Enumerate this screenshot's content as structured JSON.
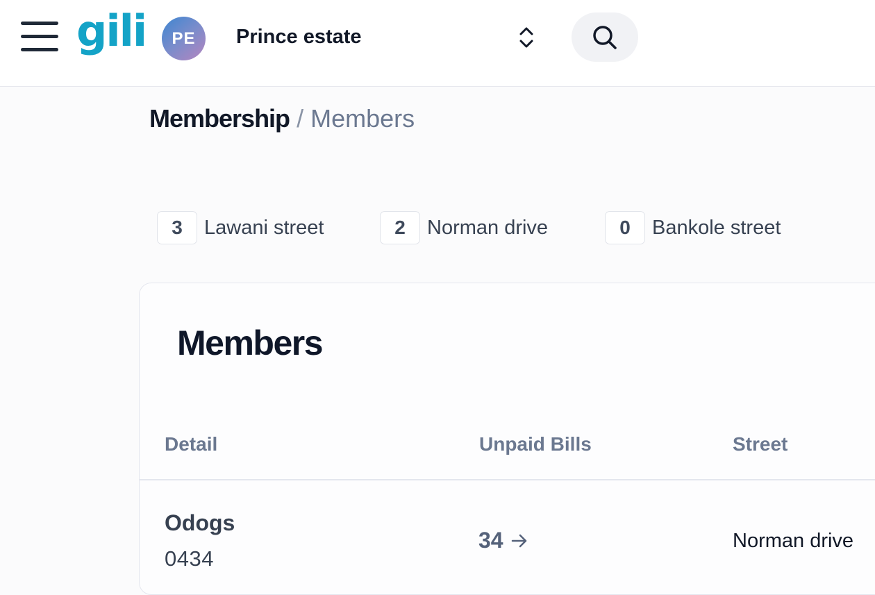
{
  "header": {
    "logo_text": "gili",
    "avatar_initials": "PE",
    "estate_name": "Prince estate"
  },
  "breadcrumb": {
    "section": "Membership",
    "separator": "/",
    "page": "Members"
  },
  "street_filters": [
    {
      "count": "3",
      "label": "Lawani street"
    },
    {
      "count": "2",
      "label": "Norman drive"
    },
    {
      "count": "0",
      "label": "Bankole street"
    }
  ],
  "members": {
    "title": "Members",
    "columns": [
      "Detail",
      "Unpaid Bills",
      "Street"
    ],
    "rows": [
      {
        "name": "Odogs",
        "id": "0434",
        "unpaid_bills": "34",
        "street": "Norman drive"
      }
    ]
  },
  "colors": {
    "brand": "#14a3c7",
    "text_primary": "#111827",
    "text_muted": "#6b7890"
  },
  "icons": {
    "menu": "hamburger-menu-icon",
    "switch": "chevron-up-down-icon",
    "search": "search-icon",
    "row_link": "arrow-right-icon"
  }
}
